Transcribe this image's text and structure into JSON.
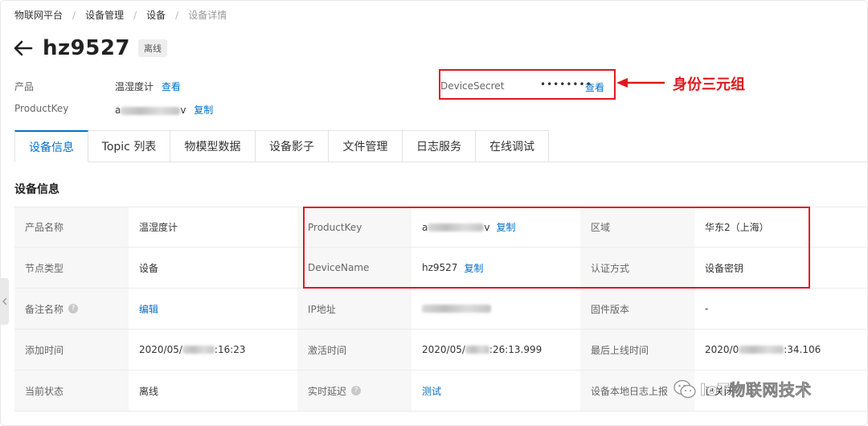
{
  "breadcrumb": [
    "物联网平台",
    "设备管理",
    "设备",
    "设备详情"
  ],
  "title": "hz9527",
  "status": "离线",
  "summary": {
    "product_label": "产品",
    "product_value": "温湿度计",
    "product_link": "查看",
    "productkey_label": "ProductKey",
    "productkey_prefix": "a",
    "productkey_suffix": "v",
    "productkey_copy": "复制",
    "secret_label": "DeviceSecret",
    "secret_value": "••••••••",
    "secret_link": "查看"
  },
  "annotation": "身份三元组",
  "tabs": [
    "设备信息",
    "Topic 列表",
    "物模型数据",
    "设备影子",
    "文件管理",
    "日志服务",
    "在线调试"
  ],
  "active_tab": "设备信息",
  "section_title": "设备信息",
  "table": {
    "r1": {
      "l1": "产品名称",
      "v1": "温湿度计",
      "l2": "ProductKey",
      "v2_prefix": "a",
      "v2_suffix": "v",
      "v2_copy": "复制",
      "l3": "区域",
      "v3": "华东2（上海）"
    },
    "r2": {
      "l1": "节点类型",
      "v1": "设备",
      "l2": "DeviceName",
      "v2": "hz9527",
      "v2_copy": "复制",
      "l3": "认证方式",
      "v3": "设备密钥"
    },
    "r3": {
      "l1": "备注名称",
      "v1": "编辑",
      "l2": "IP地址",
      "l3": "固件版本",
      "v3": "-"
    },
    "r4": {
      "l1": "添加时间",
      "v1_prefix": "2020/05/",
      "v1_suffix": ":16:23",
      "l2": "激活时间",
      "v2_prefix": "2020/05/",
      "v2_suffix": ":26:13.999",
      "l3": "最后上线时间",
      "v3_prefix": "2020/0",
      "v3_suffix": ":34.106"
    },
    "r5": {
      "l1": "当前状态",
      "v1": "离线",
      "l2": "实时延迟",
      "v2": "测试",
      "l3": "设备本地日志上报",
      "v3": "已关闭"
    }
  },
  "watermark": "IoT物联网技术",
  "colors": {
    "accent": "#0070cc",
    "annotation_red": "#e0191e"
  }
}
